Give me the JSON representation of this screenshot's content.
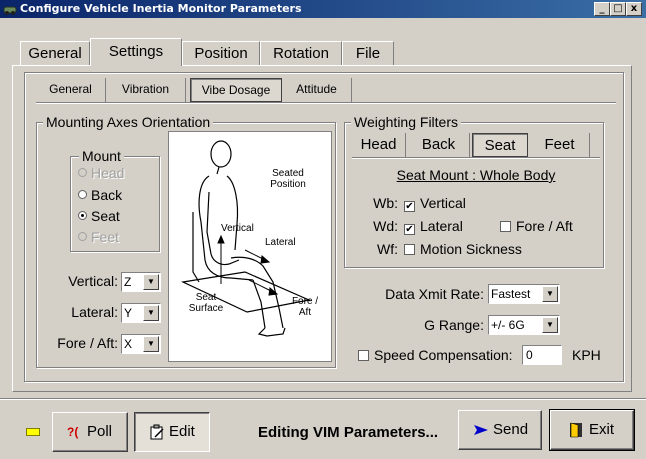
{
  "window": {
    "title": "Configure Vehicle Inertia Monitor Parameters",
    "min_label": "_",
    "max_label": "□",
    "close_label": "x"
  },
  "tabs": [
    {
      "label": "General",
      "selected": false
    },
    {
      "label": "Settings",
      "selected": true
    },
    {
      "label": "Position",
      "selected": false
    },
    {
      "label": "Rotation",
      "selected": false
    },
    {
      "label": "File",
      "selected": false
    }
  ],
  "subtabs": [
    {
      "label": "General",
      "selected": false
    },
    {
      "label": "Vibration",
      "selected": false
    },
    {
      "label": "Vibe Dosage",
      "selected": true
    },
    {
      "label": "Attitude",
      "selected": false
    }
  ],
  "mounting": {
    "group_label": "Mounting Axes Orientation",
    "mount_label": "Mount",
    "options": [
      {
        "label": "Head",
        "selected": false,
        "enabled": false
      },
      {
        "label": "Back",
        "selected": false,
        "enabled": true
      },
      {
        "label": "Seat",
        "selected": true,
        "enabled": true
      },
      {
        "label": "Feet",
        "selected": false,
        "enabled": false
      }
    ],
    "axes": [
      {
        "label": "Vertical:",
        "value": "Z"
      },
      {
        "label": "Lateral:",
        "value": "Y"
      },
      {
        "label": "Fore / Aft:",
        "value": "X"
      }
    ],
    "diagram": {
      "seated_position": "Seated Position",
      "vertical": "Vertical",
      "lateral": "Lateral",
      "seat_surface": "Seat Surface",
      "fore_aft": "Fore / Aft"
    }
  },
  "weighting": {
    "group_label": "Weighting Filters",
    "tabs": [
      {
        "label": "Head",
        "selected": false
      },
      {
        "label": "Back",
        "selected": false
      },
      {
        "label": "Seat",
        "selected": true
      },
      {
        "label": "Feet",
        "selected": false
      }
    ],
    "mount_caption": "Seat Mount : Whole Body",
    "filters": {
      "wb_label": "Wb:",
      "wb_vertical": {
        "label": "Vertical",
        "checked": true
      },
      "wd_label": "Wd:",
      "wd_lateral": {
        "label": "Lateral",
        "checked": true
      },
      "wd_foreaft": {
        "label": "Fore / Aft",
        "checked": false
      },
      "wf_label": "Wf:",
      "wf_motion": {
        "label": "Motion Sickness",
        "checked": false
      }
    }
  },
  "settings": {
    "xmit_label": "Data Xmit Rate:",
    "xmit_value": "Fastest",
    "grange_label": "G Range:",
    "grange_value": "+/- 6G",
    "speed_label": "Speed Compensation:",
    "speed_checked": false,
    "speed_value": "0",
    "speed_unit": "KPH"
  },
  "footer": {
    "poll_label": "Poll",
    "poll_icon_glyph": "?(",
    "edit_label": "Edit",
    "status": "Editing VIM Parameters...",
    "send_label": "Send",
    "exit_label": "Exit"
  },
  "colors": {
    "face": "#d4d0c8",
    "title_start": "#0a246a",
    "title_end": "#3a6ea5",
    "led": "#ffff00",
    "send_arrow": "#0000cc",
    "poll_icon": "#cc0000"
  }
}
